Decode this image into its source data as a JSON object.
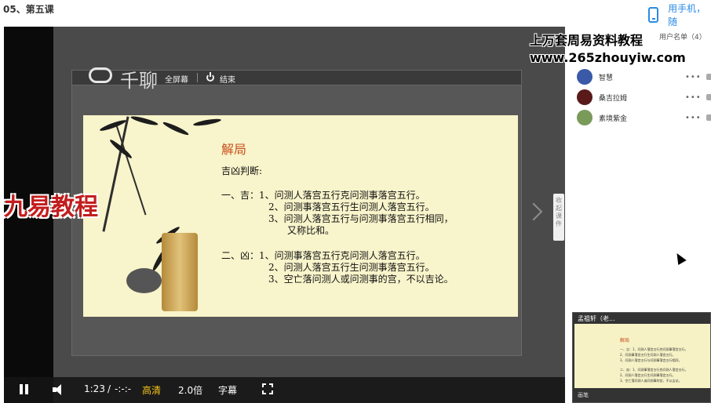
{
  "header": {
    "course_title": "05、第五课",
    "phone_link": "用手机，随"
  },
  "toolbar": {
    "logo_text": "千聊",
    "fullscreen_label": "全屏幕",
    "end_label": "结束"
  },
  "slide": {
    "title": "解局",
    "subtitle": "吉凶判断:",
    "lines": [
      "一、吉：1、问测人落宫五行克问测事落宫五行。",
      "2、问测事落宫五行生问测人落宫五行。",
      "3、问测人落宫五行与问测事落宫五行相同，",
      "又称比和。",
      "二、凶：1、问测事落宫五行克问测人落宫五行。",
      "2、问测人落宫五行生问测事落宫五行。",
      "3、空亡落问测人或问测事的宫，不以吉论。"
    ]
  },
  "watermarks": {
    "left": "九易教程",
    "top_line1": "上万套周易资料教程",
    "top_line2": "www.265zhouyiw.com"
  },
  "side_tab": "收起课件",
  "users": {
    "header": "用户名单（4）",
    "list": [
      {
        "name": "智慧"
      },
      {
        "name": "桑吉拉姆"
      },
      {
        "name": "素境紫金"
      }
    ],
    "more": "•••"
  },
  "thumbnail": {
    "title": "孟祖轩（老...",
    "slide_title": "解局",
    "foot": "画笔"
  },
  "controls": {
    "time_current": "1:23",
    "time_sep": "/",
    "time_total": "-:-:-",
    "quality": "高清",
    "speed": "2.0倍",
    "subtitles": "字幕"
  },
  "colors": {
    "accent_blue": "#2b8be6",
    "quality_yellow": "#f5c518",
    "slide_title_red": "#c8501c",
    "watermark_red": "#c31d1d"
  }
}
